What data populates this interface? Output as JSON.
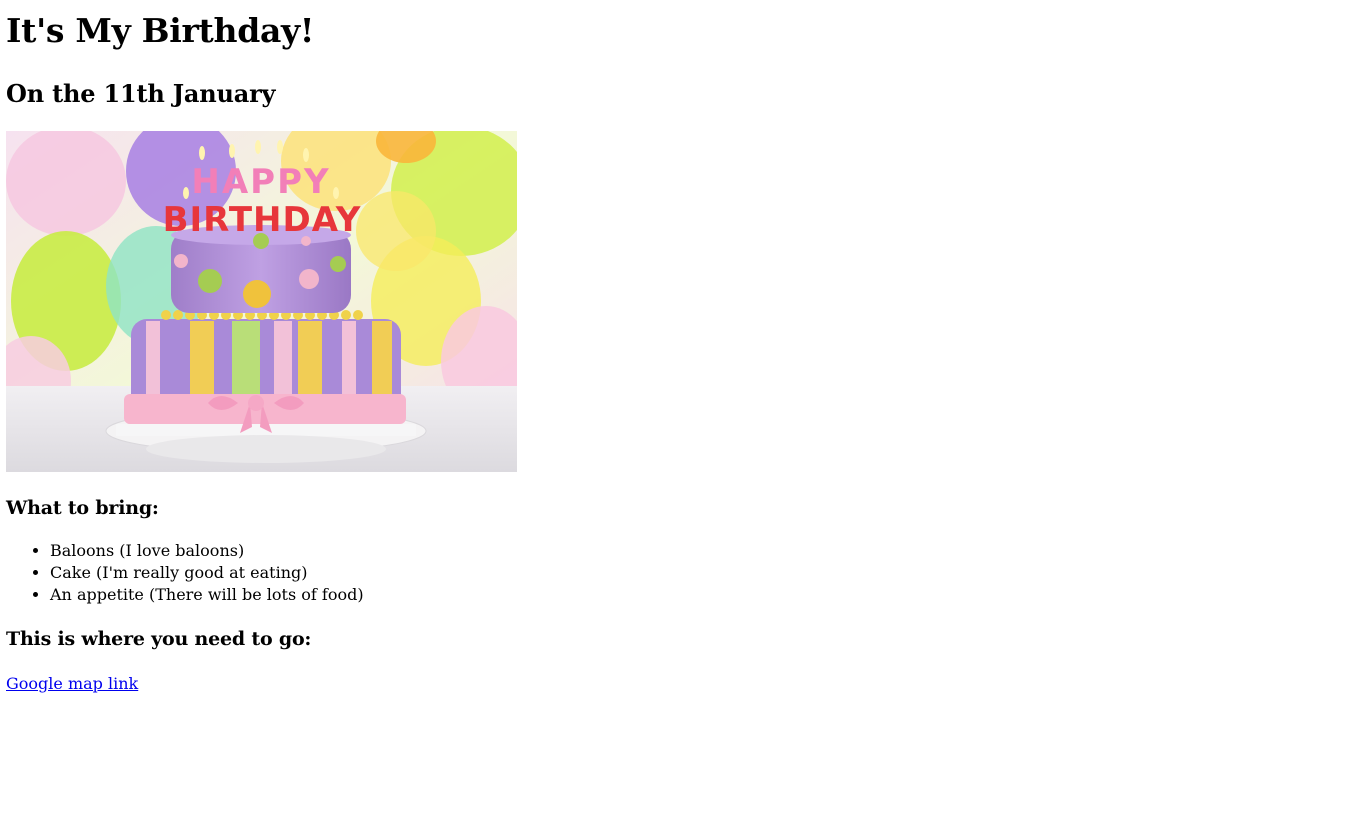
{
  "header": {
    "title": "It's My Birthday!",
    "date_line": "On the 11th January"
  },
  "photo": {
    "candles_text": "HAPPY BIRTHDAY",
    "alt": "Birthday cake"
  },
  "bring": {
    "heading": "What to bring:",
    "items": [
      "Baloons (I love baloons)",
      "Cake (I'm really good at eating)",
      "An appetite (There will be lots of food)"
    ]
  },
  "location": {
    "heading": "This is where you need to go:",
    "link_label": "Google map link"
  },
  "colors": {
    "link": "#0000ee",
    "cake_top": "#b38fd6",
    "cake_bottom": "#a582d6",
    "ribbon": "#f7b5cd"
  }
}
